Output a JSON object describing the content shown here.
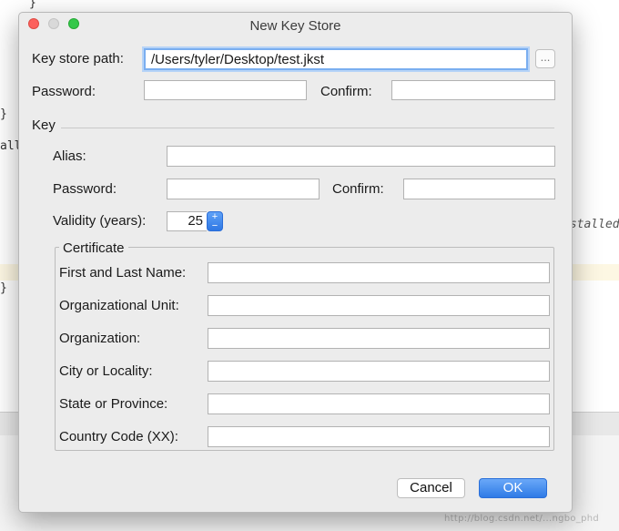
{
  "background": {
    "code_lines": [
      {
        "text": "}"
      },
      {
        "text": "}"
      },
      {
        "text": "all"
      },
      {
        "text": "nstalled"
      },
      {
        "text": "}"
      }
    ],
    "watermark": "http://blog.csdn.net/...ngbo_phd"
  },
  "dialog": {
    "title": "New Key Store",
    "key_store_path": {
      "label": "Key store path:",
      "value": "/Users/tyler/Desktop/test.jkst",
      "browse": "..."
    },
    "password": {
      "label": "Password:",
      "value": ""
    },
    "confirm": {
      "label": "Confirm:",
      "value": ""
    },
    "key_section": "Key",
    "key": {
      "alias": {
        "label": "Alias:",
        "value": ""
      },
      "password": {
        "label": "Password:",
        "value": ""
      },
      "confirm": {
        "label": "Confirm:",
        "value": ""
      },
      "validity": {
        "label": "Validity (years):",
        "value": "25",
        "up": "+",
        "down": "−"
      }
    },
    "certificate": {
      "legend": "Certificate",
      "fields": [
        {
          "label": "First and Last Name:",
          "value": ""
        },
        {
          "label": "Organizational Unit:",
          "value": ""
        },
        {
          "label": "Organization:",
          "value": ""
        },
        {
          "label": "City or Locality:",
          "value": ""
        },
        {
          "label": "State or Province:",
          "value": ""
        },
        {
          "label": "Country Code (XX):",
          "value": ""
        }
      ]
    },
    "buttons": {
      "cancel": "Cancel",
      "ok": "OK"
    }
  }
}
